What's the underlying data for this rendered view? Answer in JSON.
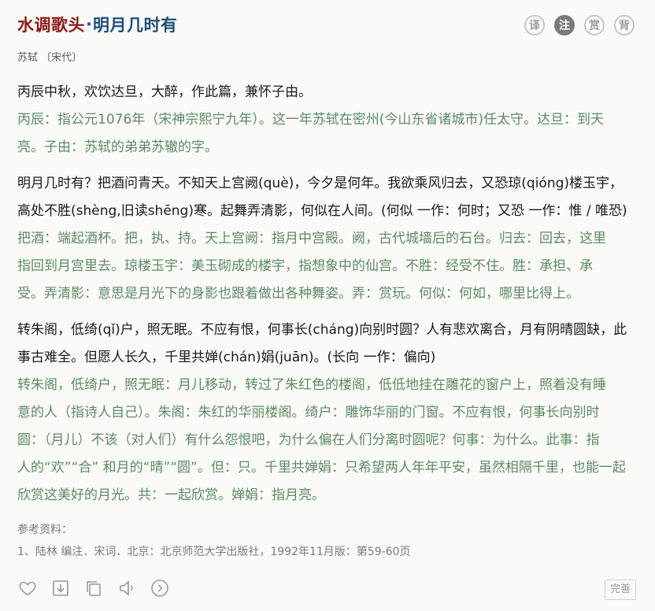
{
  "header": {
    "title_part1": "水调歌头",
    "title_sep": "·",
    "title_part2": "明月几时有",
    "buttons": [
      {
        "label": "译",
        "active": false
      },
      {
        "label": "注",
        "active": true
      },
      {
        "label": "赏",
        "active": false
      },
      {
        "label": "背",
        "active": false
      }
    ]
  },
  "author": "苏轼 〔宋代〕",
  "sections": [
    {
      "original": [
        "丙辰中秋，欢饮达旦，大醉，作此篇，兼怀子由。"
      ],
      "notes": [
        "丙辰：指公元1076年（宋神宗熙宁九年）。这一年苏轼在密州(今山东省诸城市)任太守。达旦：到天",
        "亮。子由：苏轼的弟弟苏辙的字。"
      ]
    },
    {
      "original": [
        "明月几时有？把酒问青天。不知天上宫阙(què)，今夕是何年。我欲乘风归去，又恐琼(qióng)楼玉宇，",
        "高处不胜(shèng,旧读shēng)寒。起舞弄清影，何似在人间。(何似 一作：何时；又恐 一作：惟 / 唯恐)"
      ],
      "notes": [
        "把酒：端起酒杯。把，执、持。天上宫阙：指月中宫殿。阙，古代城墙后的石台。归去：回去，这里",
        "指回到月宫里去。琼楼玉宇：美玉砌成的楼宇，指想象中的仙宫。不胜：经受不住。胜：承担、承",
        "受。弄清影：意思是月光下的身影也跟着做出各种舞姿。弄：赏玩。何似：何如，哪里比得上。"
      ]
    },
    {
      "original": [
        "转朱阁，低绮(qǐ)户，照无眠。不应有恨，何事长(cháng)向别时圆？人有悲欢离合，月有阴晴圆缺，此",
        "事古难全。但愿人长久，千里共婵(chán)娟(juān)。(长向 一作：偏向)"
      ],
      "notes": [
        "转朱阁，低绮户，照无眠：月儿移动，转过了朱红色的楼阁，低低地挂在雕花的窗户上，照着没有睡",
        "意的人（指诗人自己）。朱阁：朱红的华丽楼阁。绮户：雕饰华丽的门窗。不应有恨，何事长向别时",
        "圆：（月儿）不该（对人们）有什么怨恨吧，为什么偏在人们分离时圆呢？何事：为什么。此事：指",
        "人的“欢”“合” 和月的“晴”“圆”。但：只。千里共婵娟：只希望两人年年平安，虽然相隔千里，也能一起",
        "欣赏这美好的月光。共：一起欣赏。婵娟：指月亮。"
      ]
    }
  ],
  "references": {
    "label": "参考资料：",
    "items": [
      "1、陆林 编注．宋词．北京：北京师范大学出版社，1992年11月版：第59-60页"
    ]
  },
  "toolbar": {
    "icons": [
      "heart-icon",
      "download-icon",
      "copy-icon",
      "speaker-icon",
      "play-circle-icon"
    ],
    "improve_label": "完善"
  },
  "colors": {
    "title_red": "#8b1a1a",
    "title_blue": "#1f4f78",
    "note_green": "#5e8a66",
    "background": "#fafaf7"
  }
}
